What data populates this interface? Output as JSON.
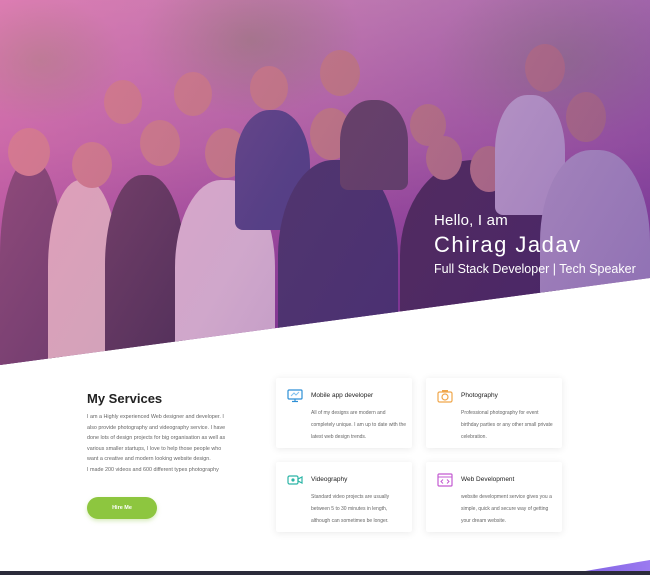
{
  "hero": {
    "greeting": "Hello, I am",
    "name": "Chirag Jadav",
    "role": "Full Stack Developer | Tech Speaker"
  },
  "services": {
    "title": "My Services",
    "description": [
      "I am a Highly experienced Web designer and developer. I",
      "also provide photography and videography service. I have",
      "done lots of design projects for big organisation as well as",
      "various smaller startups, I love to help those people who",
      "want a creative and modern looking website design.",
      "I made 200 videos and 600 different types photography"
    ],
    "button_label": "Hire Me",
    "cards": [
      {
        "icon": "monitor-icon",
        "title": "Mobile app developer",
        "text": "All of my designs are modern and completely unique. I am up to date with the latest web design trends."
      },
      {
        "icon": "camera-icon",
        "title": "Photography",
        "text": "Professional photography for event birthday parties or any other small private celebration."
      },
      {
        "icon": "video-camera-icon",
        "title": "Videography",
        "text": "Standard video projects are usually between 5 to 30 minutes in length, although can sometimes be longer."
      },
      {
        "icon": "code-window-icon",
        "title": "Web Development",
        "text": "website development service gives you a simple, quick and secure way of getting your dream website."
      }
    ]
  },
  "colors": {
    "accent_green": "#8dc63f",
    "hero_overlay": "#a04aa0",
    "icon_blue": "#2d8fd6",
    "icon_orange": "#f0a64a",
    "icon_teal": "#2cb5a6",
    "icon_purple": "#c35bd1"
  }
}
